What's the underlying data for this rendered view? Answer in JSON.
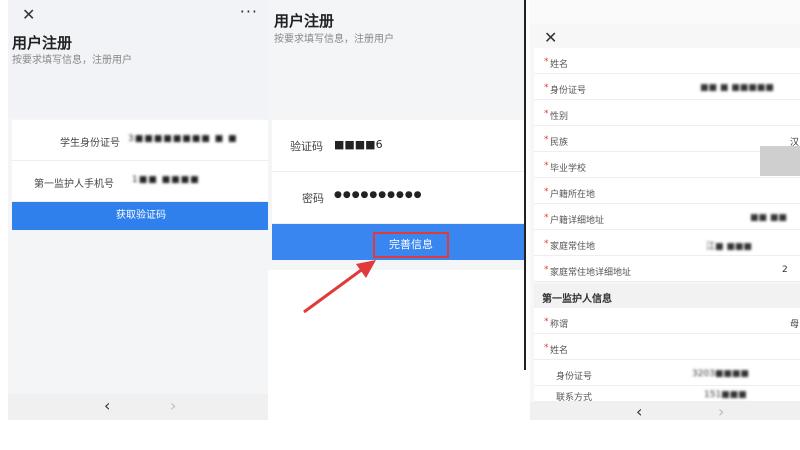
{
  "panel1": {
    "close": "✕",
    "more": "···",
    "title": "用户注册",
    "subtitle": "按要求填写信息，注册用户",
    "fields": [
      {
        "label": "学生身份证号",
        "value": "3■■■■■■■■ ■ ■"
      },
      {
        "label": "第一监护人手机号",
        "value": "1■■ ■■■■"
      }
    ],
    "button": "获取验证码",
    "nav": {
      "back": "‹",
      "forward": "›"
    }
  },
  "panel2": {
    "title": "用户注册",
    "subtitle": "按要求填写信息，注册用户",
    "fields": [
      {
        "label": "验证码",
        "value": "■■■■6"
      },
      {
        "label": "密码",
        "value": "●●●●●●●●●●"
      }
    ],
    "button": "完善信息"
  },
  "panel3": {
    "close": "✕",
    "rows": [
      {
        "label": "姓名",
        "value": "",
        "required": true
      },
      {
        "label": "身份证号",
        "value": "■■ ■ ■■■■■",
        "required": true
      },
      {
        "label": "性别",
        "value": "",
        "required": true
      },
      {
        "label": "民族",
        "value": "汉",
        "required": true
      },
      {
        "label": "毕业学校",
        "value": "",
        "required": true
      },
      {
        "label": "户籍所在地",
        "value": "",
        "required": true
      },
      {
        "label": "户籍详细地址",
        "value": "■■ ■■",
        "required": true
      },
      {
        "label": "家庭常住地",
        "value": "江■ ■■■",
        "required": true
      },
      {
        "label": "家庭常住地详细地址",
        "value": "2",
        "required": true
      }
    ],
    "section": "第一监护人信息",
    "guardian_rows": [
      {
        "label": "称谓",
        "value": "母",
        "required": true
      },
      {
        "label": "姓名",
        "value": "",
        "required": true
      },
      {
        "label": "身份证号",
        "value": "3203■■■■",
        "required": false
      },
      {
        "label": "联系方式",
        "value": "151■■■",
        "required": false
      }
    ],
    "nav": {
      "back": "‹",
      "forward": "›"
    }
  }
}
